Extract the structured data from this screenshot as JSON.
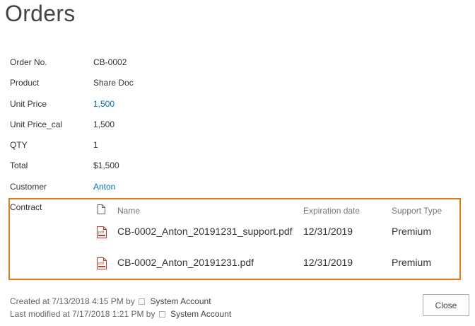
{
  "page": {
    "title": "Orders"
  },
  "fields": {
    "order_no": {
      "label": "Order No.",
      "value": "CB-0002"
    },
    "product": {
      "label": "Product",
      "value": "Share Doc"
    },
    "unit_price": {
      "label": "Unit Price",
      "value": "1,500"
    },
    "unit_price_cal": {
      "label": "Unit Price_cal",
      "value": "1,500"
    },
    "qty": {
      "label": "QTY",
      "value": "1"
    },
    "total": {
      "label": "Total",
      "value": "$1,500"
    },
    "customer": {
      "label": "Customer",
      "value": "Anton"
    }
  },
  "contract": {
    "label": "Contract",
    "columns": {
      "name": "Name",
      "expiration": "Expiration date",
      "support": "Support Type"
    },
    "documents": [
      {
        "name": "CB-0002_Anton_20191231_support.pdf",
        "expiration": "12/31/2019",
        "support": "Premium",
        "icon": "pdf-icon"
      },
      {
        "name": "CB-0002_Anton_20191231.pdf",
        "expiration": "12/31/2019",
        "support": "Premium",
        "icon": "pdf-icon"
      }
    ]
  },
  "footer": {
    "created_prefix": "Created at 7/13/2018 4:15 PM  by",
    "created_by": "System Account",
    "modified_prefix": "Last modified at 7/17/2018 1:21 PM  by",
    "modified_by": "System Account"
  },
  "actions": {
    "close_label": "Close"
  },
  "colors": {
    "accent_border": "#e07b13",
    "link": "#0072c6",
    "pdf_red": "#c0392b"
  }
}
